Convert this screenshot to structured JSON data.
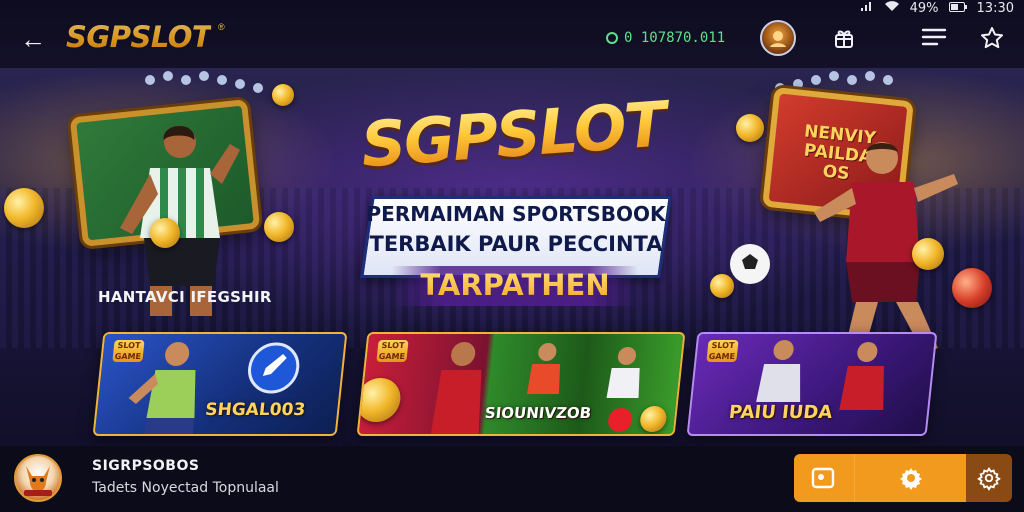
{
  "status_bar": {
    "time": "13:30",
    "battery": "49%"
  },
  "header": {
    "back_label": "←",
    "logo_text": "SGPSLOT",
    "logo_mark": "®",
    "balance": "0 107870.011"
  },
  "hero": {
    "title": "SGPSLOT",
    "subtitle_line1": "PERMAIMAN SPORTSBOOK",
    "subtitle_line2": "TERBAIK PAUR PECCINTA",
    "tagline": "TARPATHEN",
    "left_section_label": "HANTAVCI IFEGSHIR",
    "right_board_text": "NENVIY\nPAILDA\nOS"
  },
  "cards": [
    {
      "badge": "SLOT\nGAME",
      "label": "SHGAL003"
    },
    {
      "badge": "SLOT\nGAME",
      "label": "SIOUNIVZOB"
    },
    {
      "badge": "SLOT\nGAME",
      "label": "PAIU IUDA"
    }
  ],
  "app": {
    "name": "SIGRPSOBOS",
    "subtitle": "Tadets Noyectad Topnulaal"
  },
  "colors": {
    "accent_gold": "#f7b32b",
    "action_orange": "#f29a1e",
    "balance_green": "#5ee08a"
  }
}
